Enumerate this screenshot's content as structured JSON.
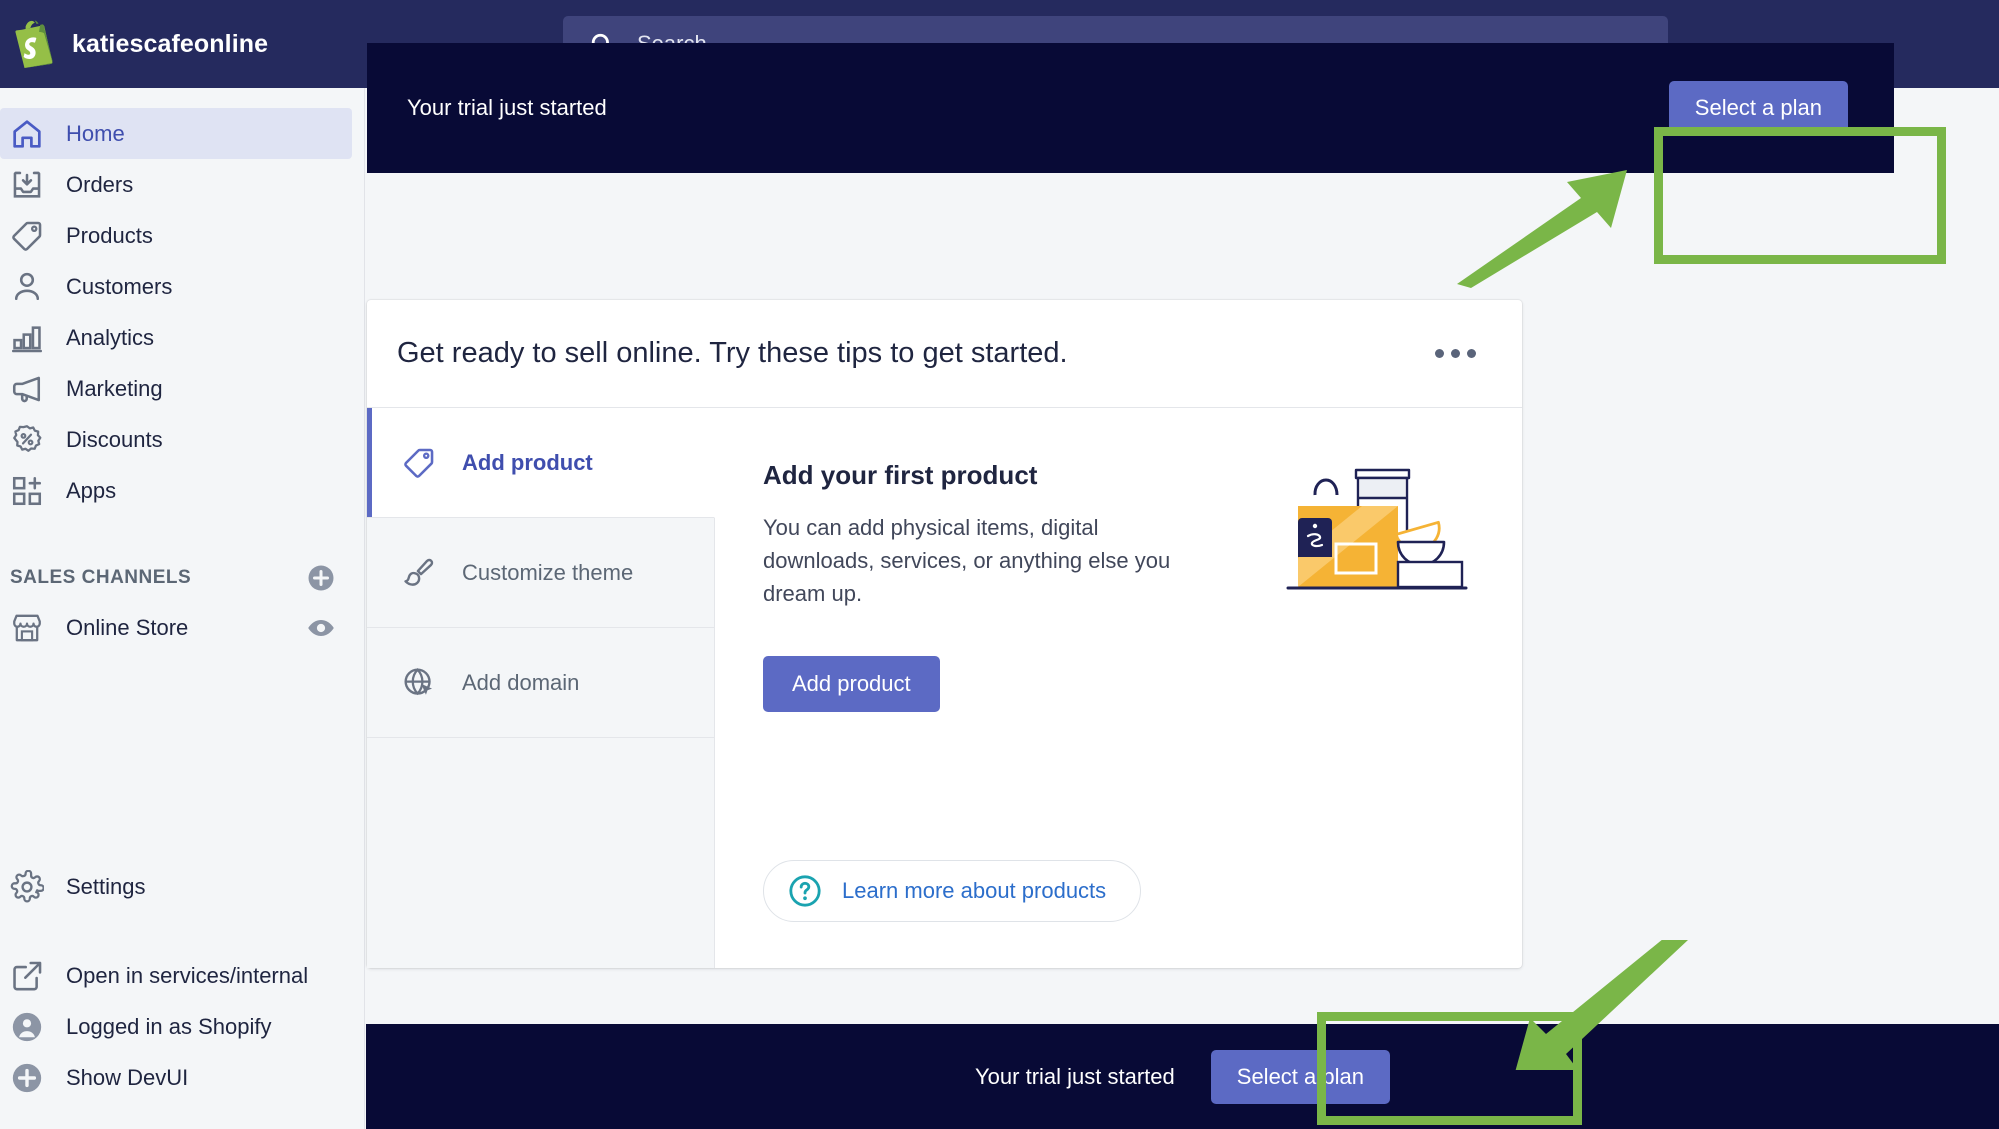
{
  "topbar": {
    "brand_name": "katiescafeonline",
    "logo_icon": "shopify-bag-icon",
    "search": {
      "icon": "search-icon",
      "placeholder": "Search",
      "value": ""
    }
  },
  "sidebar": {
    "items": [
      {
        "label": "Home",
        "icon": "home-icon",
        "active": true
      },
      {
        "label": "Orders",
        "icon": "orders-inbox-icon",
        "active": false
      },
      {
        "label": "Products",
        "icon": "product-tag-icon",
        "active": false
      },
      {
        "label": "Customers",
        "icon": "customer-person-icon",
        "active": false
      },
      {
        "label": "Analytics",
        "icon": "analytics-bar-chart-icon",
        "active": false
      },
      {
        "label": "Marketing",
        "icon": "marketing-megaphone-icon",
        "active": false
      },
      {
        "label": "Discounts",
        "icon": "discount-percent-badge-icon",
        "active": false
      },
      {
        "label": "Apps",
        "icon": "apps-grid-plus-icon",
        "active": false
      }
    ],
    "sales_channels": {
      "title": "SALES CHANNELS",
      "add_icon": "plus-circle-icon",
      "channels": [
        {
          "label": "Online Store",
          "icon": "storefront-icon",
          "action_icon": "eye-icon"
        }
      ]
    },
    "bottom_items": [
      {
        "label": "Settings",
        "icon": "gear-icon"
      },
      {
        "label": "Open in services/internal",
        "icon": "external-link-icon"
      },
      {
        "label": "Logged in as Shopify",
        "icon": "person-circle-icon"
      },
      {
        "label": "Show DevUI",
        "icon": "plus-circle-icon"
      }
    ]
  },
  "trial_banner_top": {
    "message": "Your trial just started",
    "cta_label": "Select a plan"
  },
  "trial_banner_bottom": {
    "message": "Your trial just started",
    "cta_label": "Select a plan"
  },
  "setup_card": {
    "title": "Get ready to sell online. Try these tips to get started.",
    "more_menu_icon": "kebab-menu-icon",
    "tabs": [
      {
        "label": "Add product",
        "icon": "product-tag-icon",
        "active": true
      },
      {
        "label": "Customize theme",
        "icon": "paintbrush-icon",
        "active": false
      },
      {
        "label": "Add domain",
        "icon": "globe-cursor-icon",
        "active": false
      }
    ],
    "panel": {
      "heading": "Add your first product",
      "description": "You can add physical items, digital downloads, services, or anything else you dream up.",
      "primary_button": "Add product",
      "learn_more": {
        "label": "Learn more about products",
        "icon": "question-circle-icon"
      },
      "illustration": "product-box-jar-bowls-illustration"
    }
  },
  "annotations": {
    "highlight_color": "#7ab648",
    "boxes": [
      {
        "target": "top-select-a-plan-button"
      },
      {
        "target": "bottom-select-a-plan-button"
      }
    ],
    "arrows": [
      {
        "points_to": "top-select-a-plan-button"
      },
      {
        "points_to": "bottom-select-a-plan-button"
      }
    ]
  },
  "colors": {
    "topbar_bg": "#252a5e",
    "banner_bg": "#080a36",
    "primary_button": "#5c6ac4",
    "sidebar_bg": "#f4f6f8",
    "active_nav_bg": "#dfe3f3",
    "link_blue": "#2c6ecb",
    "accent_green": "#7ab648"
  }
}
